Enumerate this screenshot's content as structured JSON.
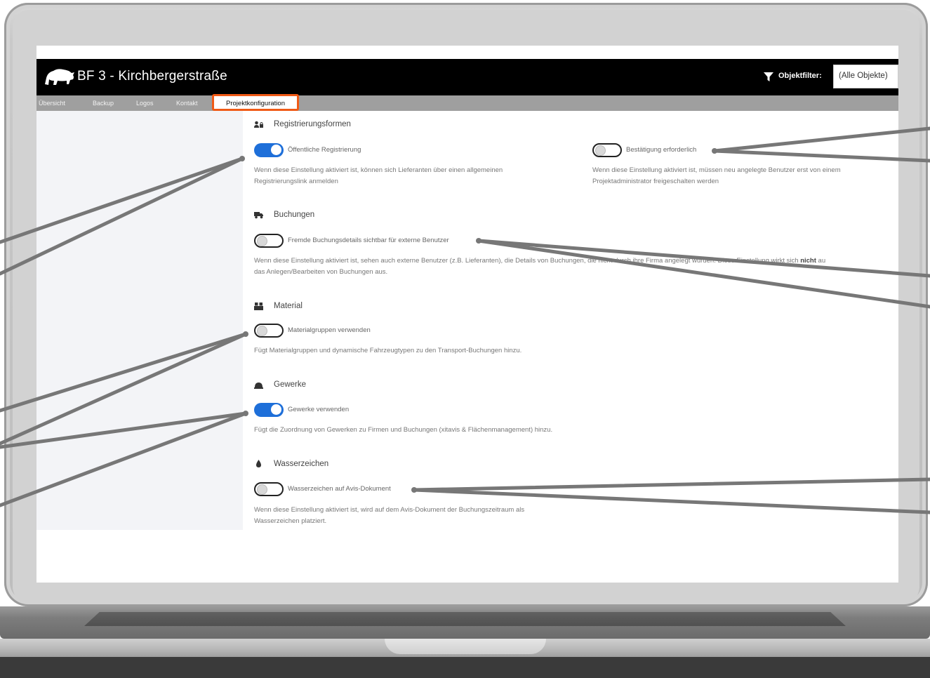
{
  "window": {
    "title": "BF 3 - Kirchbergerstraße",
    "logo_icon": "bison-logo-icon"
  },
  "header": {
    "filter_icon": "funnel-icon",
    "filter_label": "Objektfilter:",
    "filter_value": "(Alle Objekte)"
  },
  "tabs": [
    {
      "label": "Übersicht",
      "active": false
    },
    {
      "label": "Backup",
      "active": false
    },
    {
      "label": "Logos",
      "active": false
    },
    {
      "label": "Kontakt",
      "active": false
    },
    {
      "label": "Projektkonfiguration",
      "active": true
    }
  ],
  "colors": {
    "accent": "#1e6fd9",
    "highlight": "#f05a16",
    "header_bg": "#000000",
    "tab_bg": "#9f9f9f"
  },
  "sections": {
    "registrierung": {
      "icon": "users-lock-icon",
      "title": "Registrierungsformen",
      "public_toggle": {
        "label": "Öffentliche Registrierung",
        "checked": true
      },
      "public_desc_1": "Wenn diese Einstellung aktiviert ist, können sich Lieferanten über einen allgemeinen",
      "public_desc_2": "Registrierungslink anmelden",
      "confirm_toggle": {
        "label": "Bestätigung erforderlich",
        "checked": false
      },
      "confirm_desc_1": "Wenn diese Einstellung aktiviert ist, müssen neu angelegte Benutzer erst von einem",
      "confirm_desc_2": "Projektadministrator freigeschalten werden"
    },
    "buchungen": {
      "icon": "truck-icon",
      "title": "Buchungen",
      "toggle": {
        "label": "Fremde Buchungsdetails sichtbar für externe Benutzer",
        "checked": false
      },
      "desc_1": "Wenn diese Einstellung aktiviert ist, sehen auch externe Benutzer (z.B. Lieferanten), die Details von Buchungen, die nicht durch ihre Firma angelegt wurden. Diese Einstellung wirkt sich",
      "desc_1_bold": "nicht",
      "desc_1_end": "au",
      "desc_2": "das Anlegen/Bearbeiten von Buchungen aus."
    },
    "material": {
      "icon": "boxes-icon",
      "title": "Material",
      "toggle": {
        "label": "Materialgruppen verwenden",
        "checked": false
      },
      "desc": "Fügt Materialgruppen und dynamische Fahrzeugtypen zu den Transport-Buchungen hinzu."
    },
    "gewerke": {
      "icon": "hard-hat-icon",
      "title": "Gewerke",
      "toggle": {
        "label": "Gewerke verwenden",
        "checked": true
      },
      "desc": "Fügt die Zuordnung von Gewerken zu Firmen und Buchungen (xitavis & Flächenmanagement) hinzu."
    },
    "wasserzeichen": {
      "icon": "droplet-icon",
      "title": "Wasserzeichen",
      "toggle": {
        "label": "Wasserzeichen auf Avis-Dokument",
        "checked": false
      },
      "desc_1": "Wenn diese Einstellung aktiviert ist, wird auf dem Avis-Dokument der Buchungszeitraum als",
      "desc_2": "Wasserzeichen platziert."
    }
  }
}
